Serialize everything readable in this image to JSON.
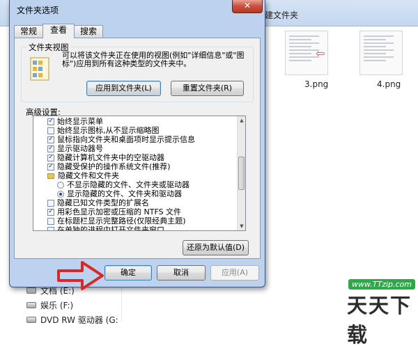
{
  "background": {
    "window_title_fragment": "建文件夹",
    "thumbnails": [
      {
        "caption": "3.png"
      },
      {
        "caption": "4.png"
      }
    ],
    "drives": [
      {
        "label": "文档 (E:)"
      },
      {
        "label": "娱乐 (F:)"
      },
      {
        "label": "DVD RW 驱动器 (G:"
      }
    ]
  },
  "dialog": {
    "title": "文件夹选项",
    "close_label": "✕",
    "tabs": [
      {
        "label": "常规"
      },
      {
        "label": "查看"
      },
      {
        "label": "搜索"
      }
    ],
    "active_tab": "查看",
    "folder_views": {
      "group_title": "文件夹视图",
      "description": "可以将该文件夹正在使用的视图(例如\"详细信息\"或\"图标\")应用到所有这种类型的文件夹中。",
      "apply_button": "应用到文件夹(L)",
      "reset_button": "重置文件夹(R)"
    },
    "advanced": {
      "label": "高级设置:",
      "items": [
        {
          "type": "checkbox",
          "checked": true,
          "label": "始终显示菜单"
        },
        {
          "type": "checkbox",
          "checked": false,
          "label": "始终显示图标,从不显示缩略图"
        },
        {
          "type": "checkbox",
          "checked": true,
          "label": "鼠标指向文件夹和桌面项时显示提示信息"
        },
        {
          "type": "checkbox",
          "checked": true,
          "label": "显示驱动器号"
        },
        {
          "type": "checkbox",
          "checked": true,
          "label": "隐藏计算机文件夹中的空驱动器"
        },
        {
          "type": "checkbox",
          "checked": true,
          "label": "隐藏受保护的操作系统文件(推荐)"
        },
        {
          "type": "folder",
          "label": "隐藏文件和文件夹"
        },
        {
          "type": "radio",
          "checked": false,
          "label": "不显示隐藏的文件、文件夹或驱动器"
        },
        {
          "type": "radio",
          "checked": true,
          "label": "显示隐藏的文件、文件夹和驱动器"
        },
        {
          "type": "checkbox",
          "checked": false,
          "label": "隐藏已知文件类型的扩展名"
        },
        {
          "type": "checkbox",
          "checked": true,
          "label": "用彩色显示加密或压缩的 NTFS 文件"
        },
        {
          "type": "checkbox",
          "checked": false,
          "label": "在标题栏显示完整路径(仅限经典主题)"
        },
        {
          "type": "checkbox",
          "checked": false,
          "label": "在单独的进程中打开文件夹窗口"
        }
      ]
    },
    "restore_defaults_button": "还原为默认值(D)",
    "ok_button": "确定",
    "cancel_button": "取消",
    "apply_button": "应用(A)"
  },
  "watermark": {
    "url": "www.TTzip.com",
    "brand": "天天下载"
  },
  "colors": {
    "dialog_frame": "#bcd2ee",
    "panel": "#f0f0f0",
    "close_red": "#c9503d",
    "annotation_red": "#d62a2a"
  }
}
